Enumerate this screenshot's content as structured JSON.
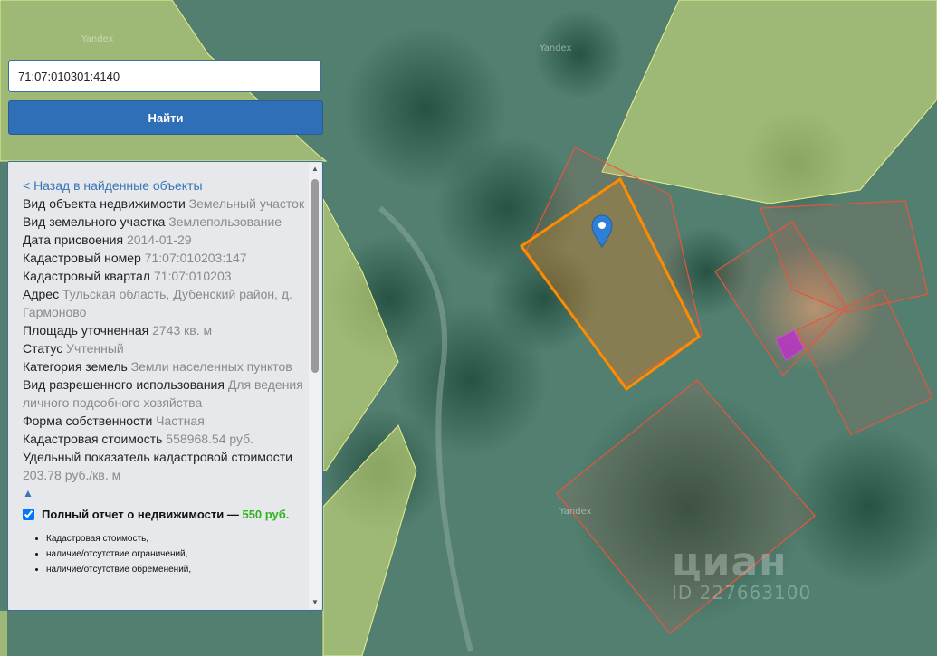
{
  "map": {
    "watermarks": [
      "Yandex",
      "Yandex",
      "Yandex"
    ],
    "overlay_logo": "циан",
    "overlay_id": "ID 227663100",
    "colors": {
      "selected_parcel": "#ff8c00",
      "neighbor_parcel": "#e8553c",
      "zone": "#dcea7a",
      "building": "#c02ad0",
      "marker": "#2f7fd6"
    }
  },
  "search": {
    "query": "71:07:010301:4140",
    "button_label": "Найти"
  },
  "panel": {
    "back_link": "< Назад в найденные объекты",
    "fields": [
      {
        "label": "Вид объекта недвижимости",
        "value": "Земельный участок"
      },
      {
        "label": "Вид земельного участка",
        "value": "Землепользование"
      },
      {
        "label": "Дата присвоения",
        "value": "2014-01-29"
      },
      {
        "label": "Кадастровый номер",
        "value": "71:07:010203:147"
      },
      {
        "label": "Кадастровый квартал",
        "value": "71:07:010203"
      },
      {
        "label": "Адрес",
        "value": "Тульская область, Дубенский район, д. Гармоново"
      },
      {
        "label": "Площадь уточненная",
        "value": "2743 кв. м"
      },
      {
        "label": "Статус",
        "value": "Учтенный"
      },
      {
        "label": "Категория земель",
        "value": "Земли населенных пунктов"
      },
      {
        "label": "Вид разрешенного использования",
        "value": "Для ведения личного подсобного хозяйства"
      },
      {
        "label": "Форма собственности",
        "value": "Частная"
      },
      {
        "label": "Кадастровая стоимость",
        "value": "558968.54 руб."
      },
      {
        "label": "Удельный показатель кадастровой стоимости",
        "value": "203.78 руб./кв. м"
      }
    ],
    "collapse_arrow": "▲",
    "report": {
      "checked": true,
      "title": "Полный отчет о недвижимости —",
      "price": "550 руб.",
      "items": [
        "Кадастровая стоимость,",
        "наличие/отсутствие ограничений,",
        "наличие/отсутствие обременений,"
      ]
    }
  }
}
